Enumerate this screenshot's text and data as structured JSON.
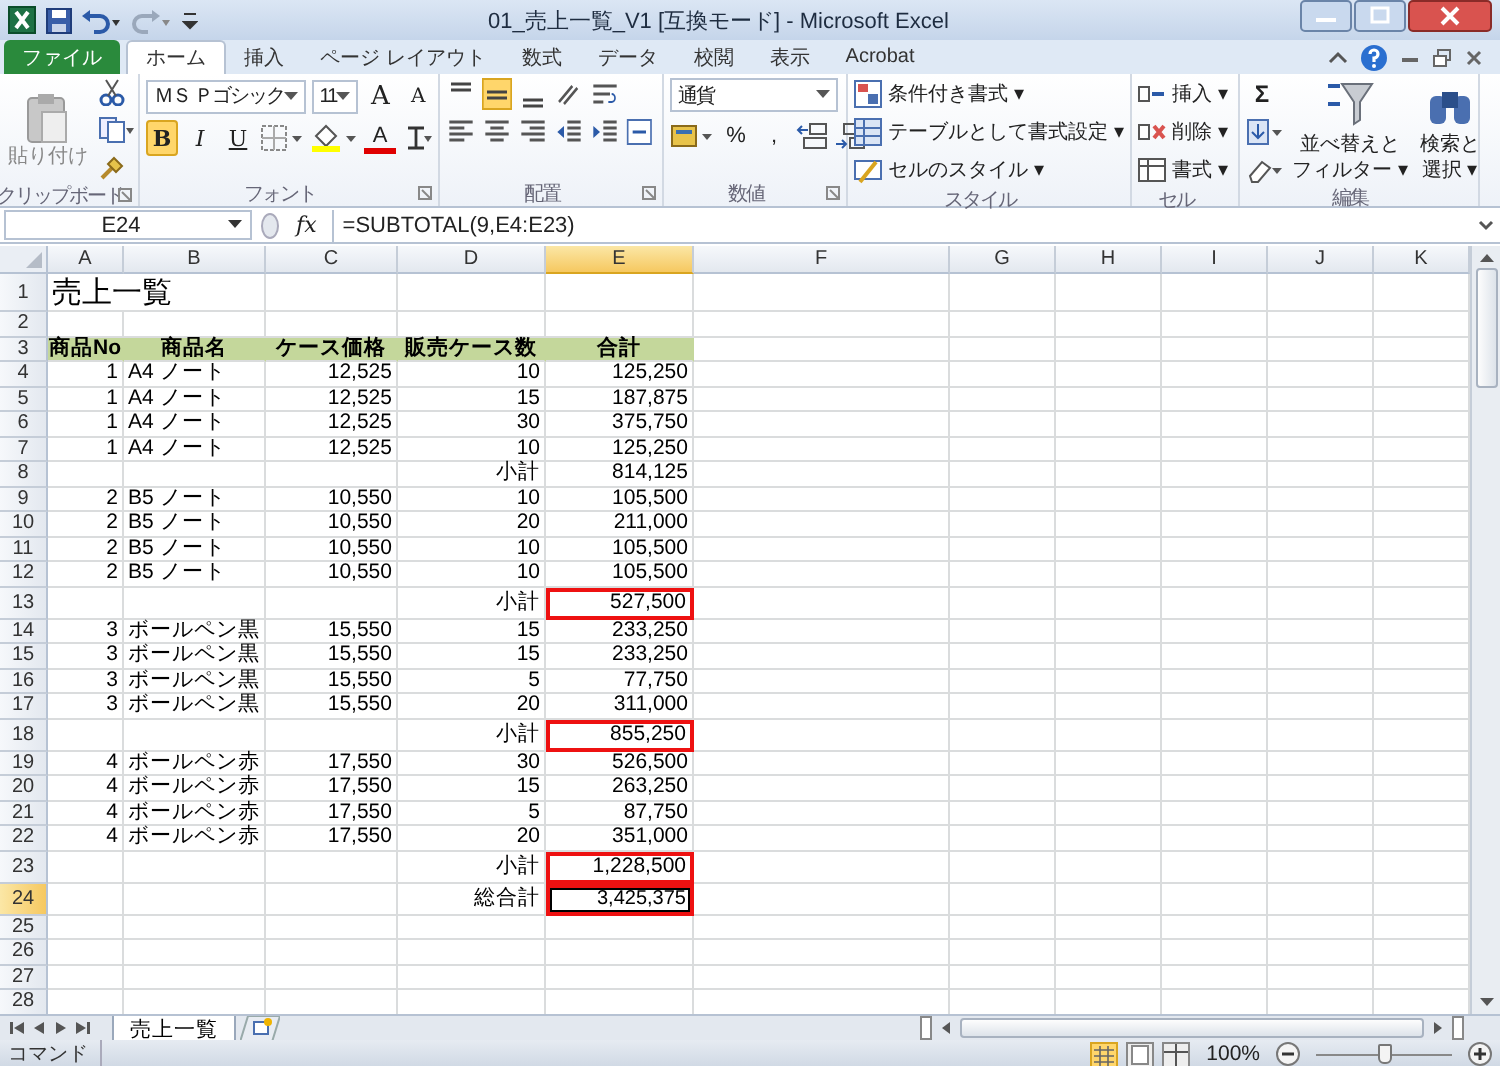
{
  "window": {
    "title": "01_売上一覧_V1  [互換モード]  -  Microsoft Excel"
  },
  "ribbon_tabs": [
    {
      "label": "ファイル",
      "kind": "file",
      "selected": false
    },
    {
      "label": "ホーム",
      "kind": "tab",
      "selected": true
    },
    {
      "label": "挿入",
      "kind": "tab",
      "selected": false
    },
    {
      "label": "ページ レイアウト",
      "kind": "tab",
      "selected": false
    },
    {
      "label": "数式",
      "kind": "tab",
      "selected": false
    },
    {
      "label": "データ",
      "kind": "tab",
      "selected": false
    },
    {
      "label": "校閲",
      "kind": "tab",
      "selected": false
    },
    {
      "label": "表示",
      "kind": "tab",
      "selected": false
    },
    {
      "label": "Acrobat",
      "kind": "tab",
      "selected": false
    }
  ],
  "ribbon": {
    "clipboard": {
      "label": "クリップボード",
      "paste": "貼り付け"
    },
    "font": {
      "label": "フォント",
      "font_name": "ＭＳ Ｐゴシック",
      "font_size": "11",
      "grow": "A",
      "shrink": "A",
      "bold": "B",
      "italic": "I",
      "underline": "U",
      "font_color": "A"
    },
    "alignment": {
      "label": "配置"
    },
    "number": {
      "label": "数値",
      "format": "通貨",
      "percent": "%",
      "comma": ","
    },
    "styles": {
      "label": "スタイル",
      "items": [
        "条件付き書式 ▾",
        "テーブルとして書式設定 ▾",
        "セルのスタイル ▾"
      ]
    },
    "cells": {
      "label": "セル",
      "items": [
        "挿入 ▾",
        "削除 ▾",
        "書式 ▾"
      ]
    },
    "editing": {
      "label": "編集",
      "sum": "Σ",
      "sort": [
        "並べ替えと",
        "フィルター ▾"
      ],
      "find": [
        "検索と",
        "選択 ▾"
      ]
    }
  },
  "formula_bar": {
    "name_box": "E24",
    "fx": "fx",
    "formula": "=SUBTOTAL(9,E4:E23)"
  },
  "columns": [
    {
      "label": "A",
      "selected": false
    },
    {
      "label": "B",
      "selected": false
    },
    {
      "label": "C",
      "selected": false
    },
    {
      "label": "D",
      "selected": false
    },
    {
      "label": "E",
      "selected": true
    },
    {
      "label": "F",
      "selected": false
    },
    {
      "label": "G",
      "selected": false
    },
    {
      "label": "H",
      "selected": false
    },
    {
      "label": "I",
      "selected": false
    },
    {
      "label": "J",
      "selected": false
    },
    {
      "label": "K",
      "selected": false
    }
  ],
  "rows": [
    {
      "number": "1",
      "kind": "title",
      "selected": false,
      "outlined": false,
      "cells": {
        "A": "売上一覧"
      }
    },
    {
      "number": "2",
      "kind": "data",
      "selected": false,
      "outlined": false,
      "cells": {}
    },
    {
      "number": "3",
      "kind": "header",
      "selected": false,
      "outlined": false,
      "cells": {
        "A": "商品No",
        "B": "商品名",
        "C": "ケース価格",
        "D": "販売ケース数",
        "E": "合計"
      }
    },
    {
      "number": "4",
      "kind": "data",
      "selected": false,
      "outlined": false,
      "cells": {
        "A": "1",
        "B": "A4 ノート",
        "C": "12,525",
        "D": "10",
        "E": "125,250"
      }
    },
    {
      "number": "5",
      "kind": "data",
      "selected": false,
      "outlined": false,
      "cells": {
        "A": "1",
        "B": "A4 ノート",
        "C": "12,525",
        "D": "15",
        "E": "187,875"
      }
    },
    {
      "number": "6",
      "kind": "data",
      "selected": false,
      "outlined": false,
      "cells": {
        "A": "1",
        "B": "A4 ノート",
        "C": "12,525",
        "D": "30",
        "E": "375,750"
      }
    },
    {
      "number": "7",
      "kind": "data",
      "selected": false,
      "outlined": false,
      "cells": {
        "A": "1",
        "B": "A4 ノート",
        "C": "12,525",
        "D": "10",
        "E": "125,250"
      }
    },
    {
      "number": "8",
      "kind": "subtotal",
      "selected": false,
      "outlined": false,
      "cells": {
        "D": "小計",
        "E": "814,125"
      }
    },
    {
      "number": "9",
      "kind": "data",
      "selected": false,
      "outlined": false,
      "cells": {
        "A": "2",
        "B": "B5 ノート",
        "C": "10,550",
        "D": "10",
        "E": "105,500"
      }
    },
    {
      "number": "10",
      "kind": "data",
      "selected": false,
      "outlined": false,
      "cells": {
        "A": "2",
        "B": "B5 ノート",
        "C": "10,550",
        "D": "20",
        "E": "211,000"
      }
    },
    {
      "number": "11",
      "kind": "data",
      "selected": false,
      "outlined": false,
      "cells": {
        "A": "2",
        "B": "B5 ノート",
        "C": "10,550",
        "D": "10",
        "E": "105,500"
      }
    },
    {
      "number": "12",
      "kind": "data",
      "selected": false,
      "outlined": false,
      "cells": {
        "A": "2",
        "B": "B5 ノート",
        "C": "10,550",
        "D": "10",
        "E": "105,500"
      }
    },
    {
      "number": "13",
      "kind": "subtotal",
      "selected": false,
      "outlined": true,
      "cells": {
        "D": "小計",
        "E": "527,500"
      }
    },
    {
      "number": "14",
      "kind": "data",
      "selected": false,
      "outlined": false,
      "cells": {
        "A": "3",
        "B": "ボールペン黒",
        "C": "15,550",
        "D": "15",
        "E": "233,250"
      }
    },
    {
      "number": "15",
      "kind": "data",
      "selected": false,
      "outlined": false,
      "cells": {
        "A": "3",
        "B": "ボールペン黒",
        "C": "15,550",
        "D": "15",
        "E": "233,250"
      }
    },
    {
      "number": "16",
      "kind": "data",
      "selected": false,
      "outlined": false,
      "cells": {
        "A": "3",
        "B": "ボールペン黒",
        "C": "15,550",
        "D": "5",
        "E": "77,750"
      }
    },
    {
      "number": "17",
      "kind": "data",
      "selected": false,
      "outlined": false,
      "cells": {
        "A": "3",
        "B": "ボールペン黒",
        "C": "15,550",
        "D": "20",
        "E": "311,000"
      }
    },
    {
      "number": "18",
      "kind": "subtotal",
      "selected": false,
      "outlined": true,
      "cells": {
        "D": "小計",
        "E": "855,250"
      }
    },
    {
      "number": "19",
      "kind": "data",
      "selected": false,
      "outlined": false,
      "cells": {
        "A": "4",
        "B": "ボールペン赤",
        "C": "17,550",
        "D": "30",
        "E": "526,500"
      }
    },
    {
      "number": "20",
      "kind": "data",
      "selected": false,
      "outlined": false,
      "cells": {
        "A": "4",
        "B": "ボールペン赤",
        "C": "17,550",
        "D": "15",
        "E": "263,250"
      }
    },
    {
      "number": "21",
      "kind": "data",
      "selected": false,
      "outlined": false,
      "cells": {
        "A": "4",
        "B": "ボールペン赤",
        "C": "17,550",
        "D": "5",
        "E": "87,750"
      }
    },
    {
      "number": "22",
      "kind": "data",
      "selected": false,
      "outlined": false,
      "cells": {
        "A": "4",
        "B": "ボールペン赤",
        "C": "17,550",
        "D": "20",
        "E": "351,000"
      }
    },
    {
      "number": "23",
      "kind": "subtotal",
      "selected": false,
      "outlined": true,
      "cells": {
        "D": "小計",
        "E": "1,228,500"
      }
    },
    {
      "number": "24",
      "kind": "total",
      "selected": true,
      "outlined": true,
      "cells": {
        "D": "総合計",
        "E": "3,425,375"
      }
    },
    {
      "number": "25",
      "kind": "data",
      "selected": false,
      "outlined": false,
      "cells": {}
    },
    {
      "number": "26",
      "kind": "data",
      "selected": false,
      "outlined": false,
      "cells": {}
    },
    {
      "number": "27",
      "kind": "data",
      "selected": false,
      "outlined": false,
      "cells": {}
    },
    {
      "number": "28",
      "kind": "data",
      "selected": false,
      "outlined": false,
      "cells": {}
    }
  ],
  "sheet_tabs": [
    {
      "label": "売上一覧",
      "selected": true
    }
  ],
  "status_bar": {
    "mode": "コマンド",
    "zoom": "100%",
    "zoom_slider": {
      "level": 0.5
    }
  }
}
